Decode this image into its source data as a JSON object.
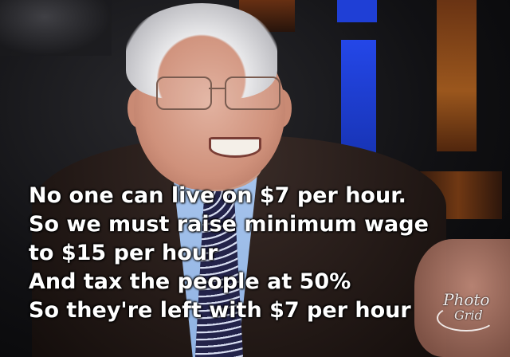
{
  "caption": {
    "lines": [
      "No one can live on $7 per hour.",
      "So we must raise minimum wage",
      "to $15 per hour",
      "And tax the people at 50%",
      "So they're left with $7 per hour"
    ]
  },
  "watermark": {
    "line1": "Photo",
    "line2": "Grid"
  },
  "colors": {
    "caption_text": "#ffffff",
    "background_blue": "#2447e8",
    "background_amber": "#b3631f",
    "suit": "#241a17",
    "shirt": "#a9c6ee",
    "tie": "#23234a"
  }
}
